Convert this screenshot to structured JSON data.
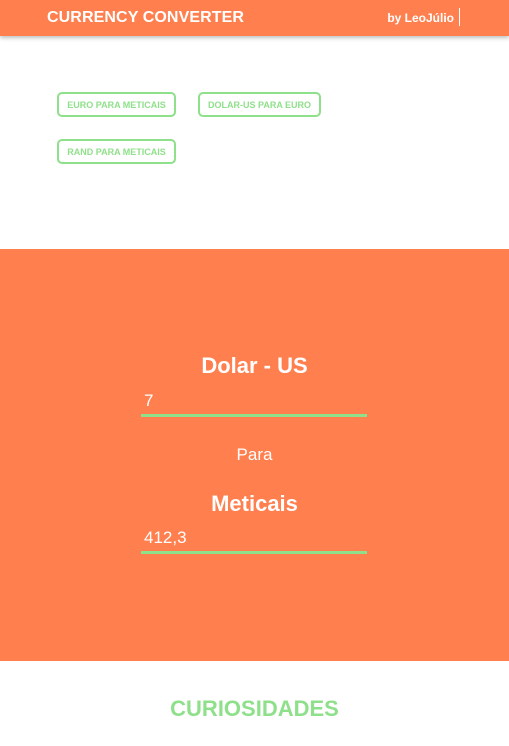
{
  "header": {
    "title": "CURRENCY CONVERTER",
    "author": "by LeoJúlio"
  },
  "options": [
    {
      "label": "EURO PARA METICAIS"
    },
    {
      "label": "DOLAR-US PARA EURO"
    },
    {
      "label": "RAND PARA METICAIS"
    }
  ],
  "converter": {
    "from_currency": "Dolar - US",
    "from_value": "7",
    "connector": "Para",
    "to_currency": "Meticais",
    "to_value": "412,3"
  },
  "section": {
    "title": "CURIOSIDADES"
  },
  "colors": {
    "primary": "#ff7f4f",
    "accent": "#8fe08a"
  }
}
